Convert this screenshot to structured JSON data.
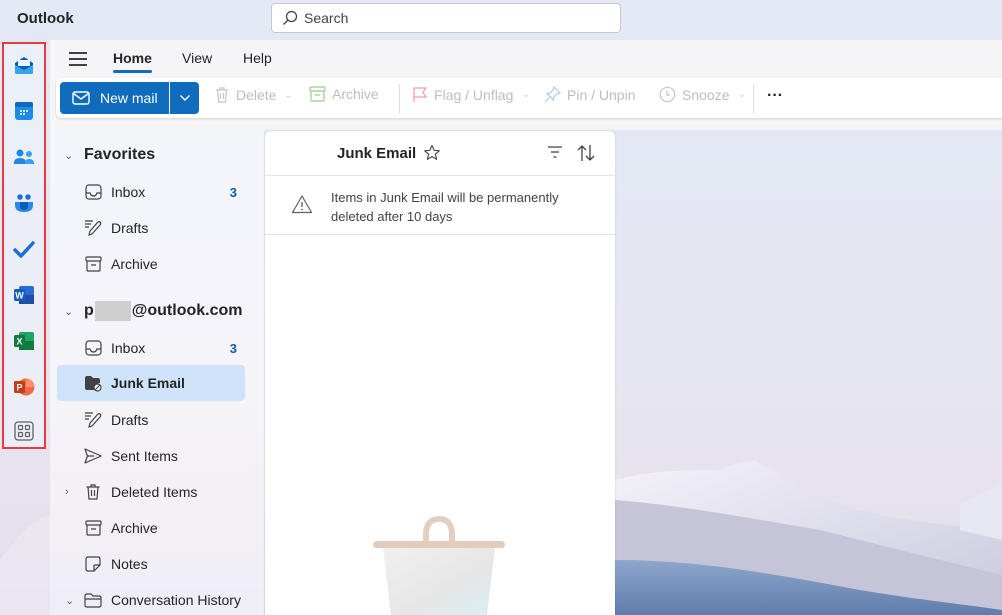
{
  "app": {
    "title": "Outlook"
  },
  "search": {
    "placeholder": "Search"
  },
  "rail": {
    "items": [
      {
        "name": "mail",
        "icon": "mail-icon"
      },
      {
        "name": "calendar",
        "icon": "calendar-icon"
      },
      {
        "name": "people",
        "icon": "people-icon"
      },
      {
        "name": "teams",
        "icon": "teams-icon"
      },
      {
        "name": "todo",
        "icon": "todo-check-icon"
      },
      {
        "name": "word",
        "icon": "word-icon",
        "letter": "W"
      },
      {
        "name": "excel",
        "icon": "excel-icon",
        "letter": "X"
      },
      {
        "name": "powerpoint",
        "icon": "powerpoint-icon",
        "letter": "P"
      },
      {
        "name": "more-apps",
        "icon": "apps-grid-icon"
      }
    ]
  },
  "ribbon": {
    "tabs": [
      {
        "label": "Home",
        "active": true
      },
      {
        "label": "View",
        "active": false
      },
      {
        "label": "Help",
        "active": false
      }
    ],
    "toolbar": {
      "new_mail": "New mail",
      "delete": "Delete",
      "archive": "Archive",
      "flag": "Flag / Unflag",
      "pin": "Pin / Unpin",
      "snooze": "Snooze",
      "more": "···"
    }
  },
  "folders": {
    "favorites": {
      "label": "Favorites",
      "items": [
        {
          "label": "Inbox",
          "count": "3",
          "icon": "inbox-icon"
        },
        {
          "label": "Drafts",
          "count": "",
          "icon": "drafts-icon"
        },
        {
          "label": "Archive",
          "count": "",
          "icon": "archive-icon"
        }
      ]
    },
    "account": {
      "label_prefix": "p",
      "label_suffix": "@outlook.com",
      "items": [
        {
          "label": "Inbox",
          "count": "3",
          "icon": "inbox-icon"
        },
        {
          "label": "Junk Email",
          "count": "",
          "icon": "junk-icon",
          "selected": true
        },
        {
          "label": "Drafts",
          "count": "",
          "icon": "drafts-icon"
        },
        {
          "label": "Sent Items",
          "count": "",
          "icon": "sent-icon"
        },
        {
          "label": "Deleted Items",
          "count": "",
          "icon": "trash-icon",
          "expandable": true
        },
        {
          "label": "Archive",
          "count": "",
          "icon": "archive-icon"
        },
        {
          "label": "Notes",
          "count": "",
          "icon": "notes-icon"
        },
        {
          "label": "Conversation History",
          "count": "",
          "icon": "folder-icon",
          "expanded": true
        }
      ]
    }
  },
  "message_list": {
    "title": "Junk Email",
    "notice": "Items in Junk Email will be permanently deleted after 10 days"
  },
  "colors": {
    "accent": "#0f6cbd",
    "selected_bg": "#cfe4fa",
    "count": "#115ea3",
    "highlight_border": "#e8393f"
  }
}
